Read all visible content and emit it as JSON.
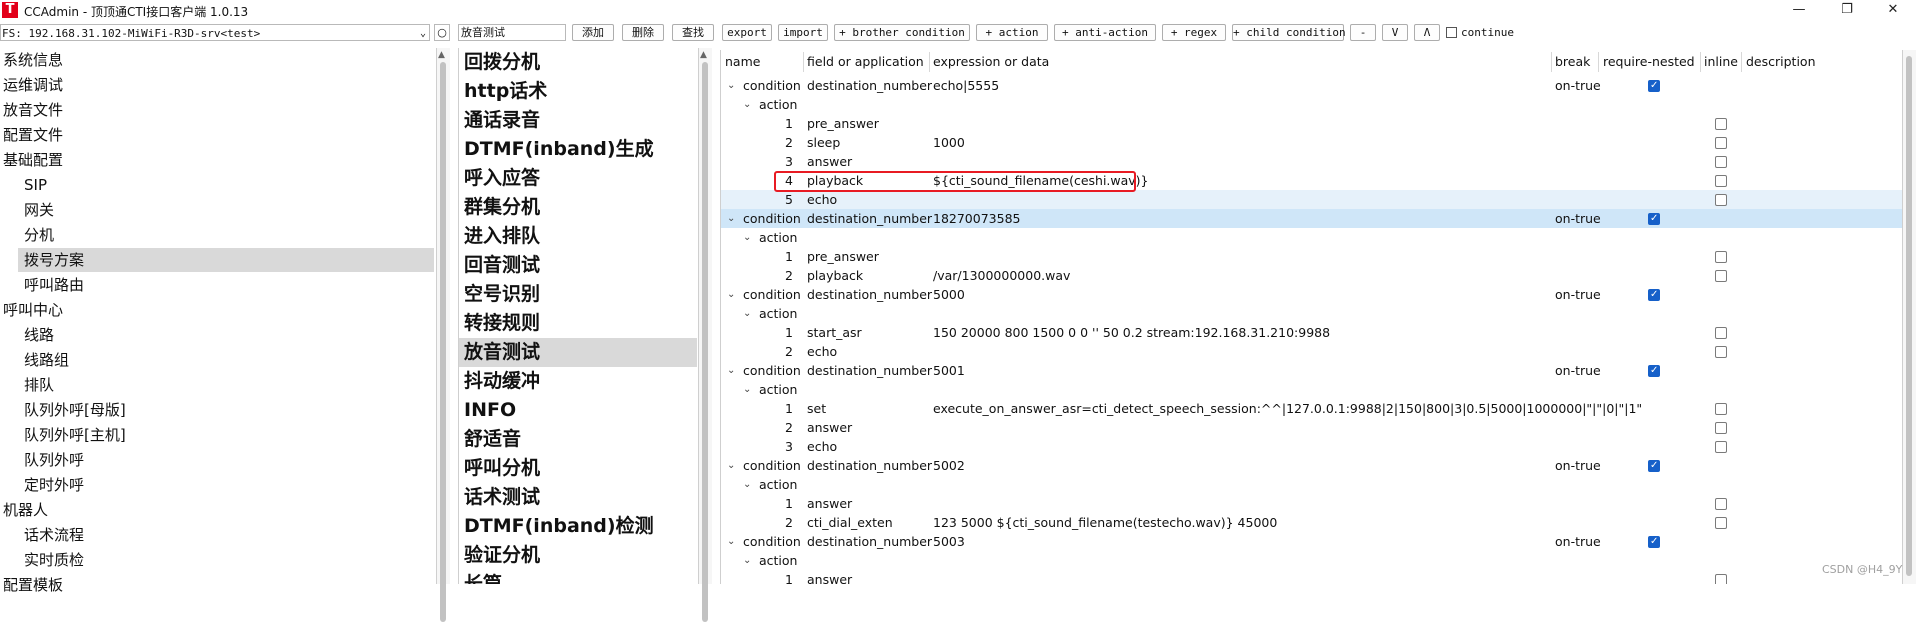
{
  "window": {
    "icon_glyph": "T",
    "title": "CCAdmin - 顶顶通CTI接口客户端 1.0.13",
    "minimize_glyph": "—",
    "maximize_glyph": "❐",
    "close_glyph": "✕"
  },
  "toolbar": {
    "fs_value": "FS: 192.168.31.102-MiWiFi-R3D-srv<test>",
    "fs_arrow": "⌄",
    "refresh_glyph": "○",
    "search_value": "放音测试",
    "buttons": {
      "add": "添加",
      "delete": "删除",
      "find": "查找",
      "export": "export",
      "import": "import",
      "brother": "+ brother condition",
      "action": "+ action",
      "anti": "+ anti-action",
      "regex": "+ regex",
      "child": "+ child condition",
      "minus": "-",
      "down": "V",
      "up": "Λ"
    },
    "continue_label": "continue"
  },
  "nav": {
    "items": [
      {
        "label": "系统信息",
        "level": 0
      },
      {
        "label": "运维调试",
        "level": 0
      },
      {
        "label": "放音文件",
        "level": 0
      },
      {
        "label": "配置文件",
        "level": 0
      },
      {
        "label": "基础配置",
        "level": 0
      },
      {
        "label": "SIP",
        "level": 1
      },
      {
        "label": "网关",
        "level": 1
      },
      {
        "label": "分机",
        "level": 1
      },
      {
        "label": "拨号方案",
        "level": 1,
        "selected": true
      },
      {
        "label": "呼叫路由",
        "level": 1
      },
      {
        "label": "呼叫中心",
        "level": 0
      },
      {
        "label": "线路",
        "level": 1
      },
      {
        "label": "线路组",
        "level": 1
      },
      {
        "label": "排队",
        "level": 1
      },
      {
        "label": "队列外呼[母版]",
        "level": 1
      },
      {
        "label": "队列外呼[主机]",
        "level": 1
      },
      {
        "label": "队列外呼",
        "level": 1
      },
      {
        "label": "定时外呼",
        "level": 1
      },
      {
        "label": "机器人",
        "level": 0
      },
      {
        "label": "话术流程",
        "level": 1
      },
      {
        "label": "实时质检",
        "level": 1
      },
      {
        "label": "配置模板",
        "level": 0
      }
    ]
  },
  "dialplans": {
    "items": [
      "回拨分机",
      "http话术",
      "通话录音",
      "DTMF(inband)生成",
      "呼入应答",
      "群集分机",
      "进入排队",
      "回音测试",
      "空号识别",
      "转接规则",
      "放音测试",
      "抖动缓冲",
      "INFO",
      "舒适音",
      "呼叫分机",
      "话术测试",
      "DTMF(inband)检测",
      "验证分机",
      "长篇"
    ],
    "selected": "放音测试"
  },
  "tree": {
    "headers": {
      "name": "name",
      "field": "field or application",
      "expr": "expression or data",
      "break": "break",
      "require": "require-nested",
      "inline": "inline",
      "desc": "description"
    },
    "rows": [
      {
        "type": "condition",
        "name": "condition",
        "field": "destination_number",
        "expr": "echo|5555",
        "break": "on-true",
        "require": true
      },
      {
        "type": "action-group",
        "name": "action"
      },
      {
        "type": "item",
        "num": "1",
        "field": "pre_answer",
        "expr": "",
        "inline": false
      },
      {
        "type": "item",
        "num": "2",
        "field": "sleep",
        "expr": "1000",
        "inline": false
      },
      {
        "type": "item",
        "num": "3",
        "field": "answer",
        "expr": "",
        "inline": false
      },
      {
        "type": "item",
        "num": "4",
        "field": "playback",
        "expr": "${cti_sound_filename(ceshi.wav)}",
        "inline": false,
        "boxed": true
      },
      {
        "type": "item",
        "num": "5",
        "field": "echo",
        "expr": "",
        "inline": false,
        "highlight": "light"
      },
      {
        "type": "condition",
        "name": "condition",
        "field": "destination_number",
        "expr": "18270073585",
        "break": "on-true",
        "require": true,
        "highlight": "strong"
      },
      {
        "type": "action-group",
        "name": "action"
      },
      {
        "type": "item",
        "num": "1",
        "field": "pre_answer",
        "expr": "",
        "inline": false
      },
      {
        "type": "item",
        "num": "2",
        "field": "playback",
        "expr": "/var/1300000000.wav",
        "inline": false
      },
      {
        "type": "condition",
        "name": "condition",
        "field": "destination_number",
        "expr": "5000",
        "break": "on-true",
        "require": true
      },
      {
        "type": "action-group",
        "name": "action"
      },
      {
        "type": "item",
        "num": "1",
        "field": "start_asr",
        "expr": "150 20000 800 1500 0 0 '' 50 0.2 stream:192.168.31.210:9988",
        "inline": false
      },
      {
        "type": "item",
        "num": "2",
        "field": "echo",
        "expr": "",
        "inline": false
      },
      {
        "type": "condition",
        "name": "condition",
        "field": "destination_number",
        "expr": "5001",
        "break": "on-true",
        "require": true
      },
      {
        "type": "action-group",
        "name": "action"
      },
      {
        "type": "item",
        "num": "1",
        "field": "set",
        "expr": "execute_on_answer_asr=cti_detect_speech_session:^^|127.0.0.1:9988|2|150|800|3|0.5|5000|1000000|\"|\"|0|\"|1\"",
        "inline": false
      },
      {
        "type": "item",
        "num": "2",
        "field": "answer",
        "expr": "",
        "inline": false
      },
      {
        "type": "item",
        "num": "3",
        "field": "echo",
        "expr": "",
        "inline": false
      },
      {
        "type": "condition",
        "name": "condition",
        "field": "destination_number",
        "expr": "5002",
        "break": "on-true",
        "require": true
      },
      {
        "type": "action-group",
        "name": "action"
      },
      {
        "type": "item",
        "num": "1",
        "field": "answer",
        "expr": "",
        "inline": false
      },
      {
        "type": "item",
        "num": "2",
        "field": "cti_dial_exten",
        "expr": "123 5000 ${cti_sound_filename(testecho.wav)} 45000",
        "inline": false
      },
      {
        "type": "condition",
        "name": "condition",
        "field": "destination_number",
        "expr": "5003",
        "break": "on-true",
        "require": true
      },
      {
        "type": "action-group",
        "name": "action"
      },
      {
        "type": "item",
        "num": "1",
        "field": "answer",
        "expr": "",
        "inline": false
      }
    ],
    "chevron_glyph": "⌄"
  },
  "watermark": "CSDN @H4_9Y"
}
